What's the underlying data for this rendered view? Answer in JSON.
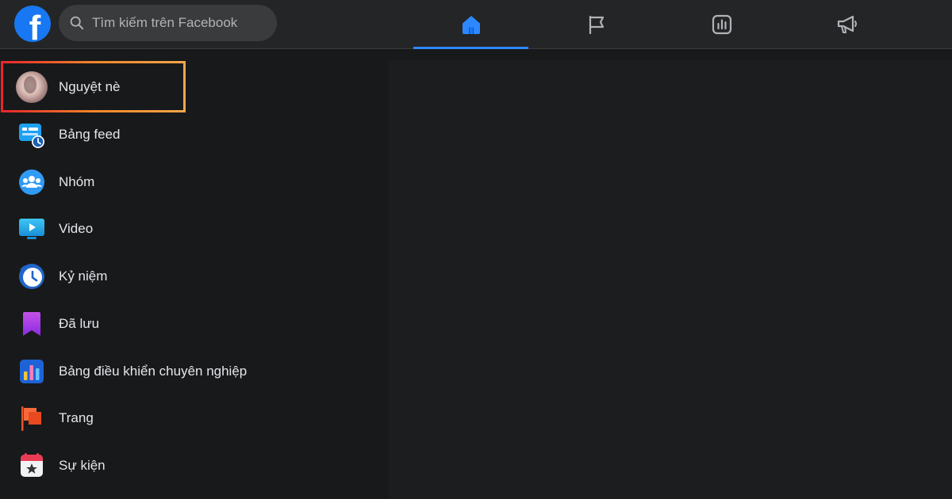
{
  "header": {
    "logo_letter": "f",
    "search_placeholder": "Tìm kiếm trên Facebook",
    "tabs": [
      {
        "name": "home-icon",
        "active": true
      },
      {
        "name": "flag-icon",
        "active": false
      },
      {
        "name": "chart-icon",
        "active": false
      },
      {
        "name": "megaphone-icon",
        "active": false
      }
    ]
  },
  "sidebar": {
    "items": [
      {
        "label": "Nguyệt nè",
        "icon": "avatar"
      },
      {
        "label": "Bảng feed",
        "icon": "feed-icon"
      },
      {
        "label": "Nhóm",
        "icon": "groups-icon"
      },
      {
        "label": "Video",
        "icon": "video-icon"
      },
      {
        "label": "Kỷ niệm",
        "icon": "memories-icon"
      },
      {
        "label": "Đã lưu",
        "icon": "saved-icon"
      },
      {
        "label": "Bảng điều khiển chuyên nghiệp",
        "icon": "dashboard-icon"
      },
      {
        "label": "Trang",
        "icon": "pages-icon"
      },
      {
        "label": "Sự kiện",
        "icon": "events-icon"
      }
    ]
  },
  "colors": {
    "brand": "#1877f2",
    "active_tab": "#2d88ff",
    "highlight_start": "#e8262c",
    "highlight_end": "#f5a54a"
  }
}
